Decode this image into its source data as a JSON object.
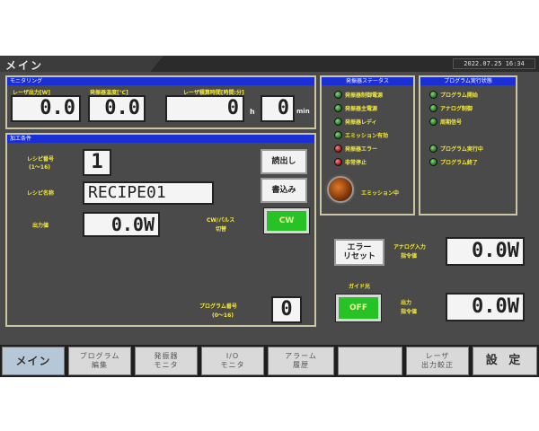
{
  "header": {
    "title": "メイン",
    "datetime": "2022.07.25  16:34"
  },
  "monitoring": {
    "title": "モニタリング",
    "laser_output_label": "レーザ出力[W]",
    "laser_output_value": "0.0",
    "temp_label": "発振器温度[℃]",
    "temp_value": "0.0",
    "time_label": "レーザ積算時間[時間:分]",
    "hours_value": "0",
    "hours_unit": "h",
    "minutes_value": "0",
    "minutes_unit": "min"
  },
  "processing": {
    "title": "加工条件",
    "recipe_no_label": "レシピ番号",
    "recipe_no_range": "(1〜16)",
    "recipe_no_value": "1",
    "recipe_name_label": "レシピ名称",
    "recipe_name_value": "RECIPE01",
    "output_label": "出力値",
    "output_value": "0.0W",
    "read_button": "読出し",
    "write_button": "書込み",
    "mode_label_1": "CW/パルス",
    "mode_label_2": "切替",
    "mode_button": "CW",
    "program_no_label": "プログラム番号",
    "program_no_range": "(0〜16)",
    "program_no_value": "0"
  },
  "osc_status": {
    "title": "発振器ステータス",
    "items": [
      {
        "label": "発振器制御電源",
        "color": "green"
      },
      {
        "label": "発振器主電源",
        "color": "green"
      },
      {
        "label": "発振器レディ",
        "color": "green"
      },
      {
        "label": "エミッション有効",
        "color": "green"
      },
      {
        "label": "発振器エラー",
        "color": "red"
      },
      {
        "label": "非常停止",
        "color": "red"
      }
    ],
    "emission_label": "エミッション中"
  },
  "program_status": {
    "title": "プログラム実行状態",
    "items": [
      {
        "label": "プログラム開始"
      },
      {
        "label": "アナログ制御"
      },
      {
        "label": "周期信号"
      },
      {
        "label": "プログラム実行中"
      },
      {
        "label": "プログラム終了"
      }
    ]
  },
  "right_controls": {
    "error_reset_1": "エラー",
    "error_reset_2": "リセット",
    "analog_label_1": "アナログ入力",
    "analog_label_2": "指令値",
    "analog_value": "0.0W",
    "guide_label": "ガイド光",
    "guide_button": "OFF",
    "output_cmd_label_1": "出力",
    "output_cmd_label_2": "指令値",
    "output_cmd_value": "0.0W"
  },
  "nav": [
    {
      "line1": "メイン",
      "line2": ""
    },
    {
      "line1": "プログラム",
      "line2": "編集"
    },
    {
      "line1": "発振器",
      "line2": "モニタ"
    },
    {
      "line1": "I/O",
      "line2": "モニタ"
    },
    {
      "line1": "アラーム",
      "line2": "履歴"
    },
    {
      "line1": "",
      "line2": ""
    },
    {
      "line1": "レーザ",
      "line2": "出力較正"
    },
    {
      "line1": "設 定",
      "line2": ""
    }
  ]
}
